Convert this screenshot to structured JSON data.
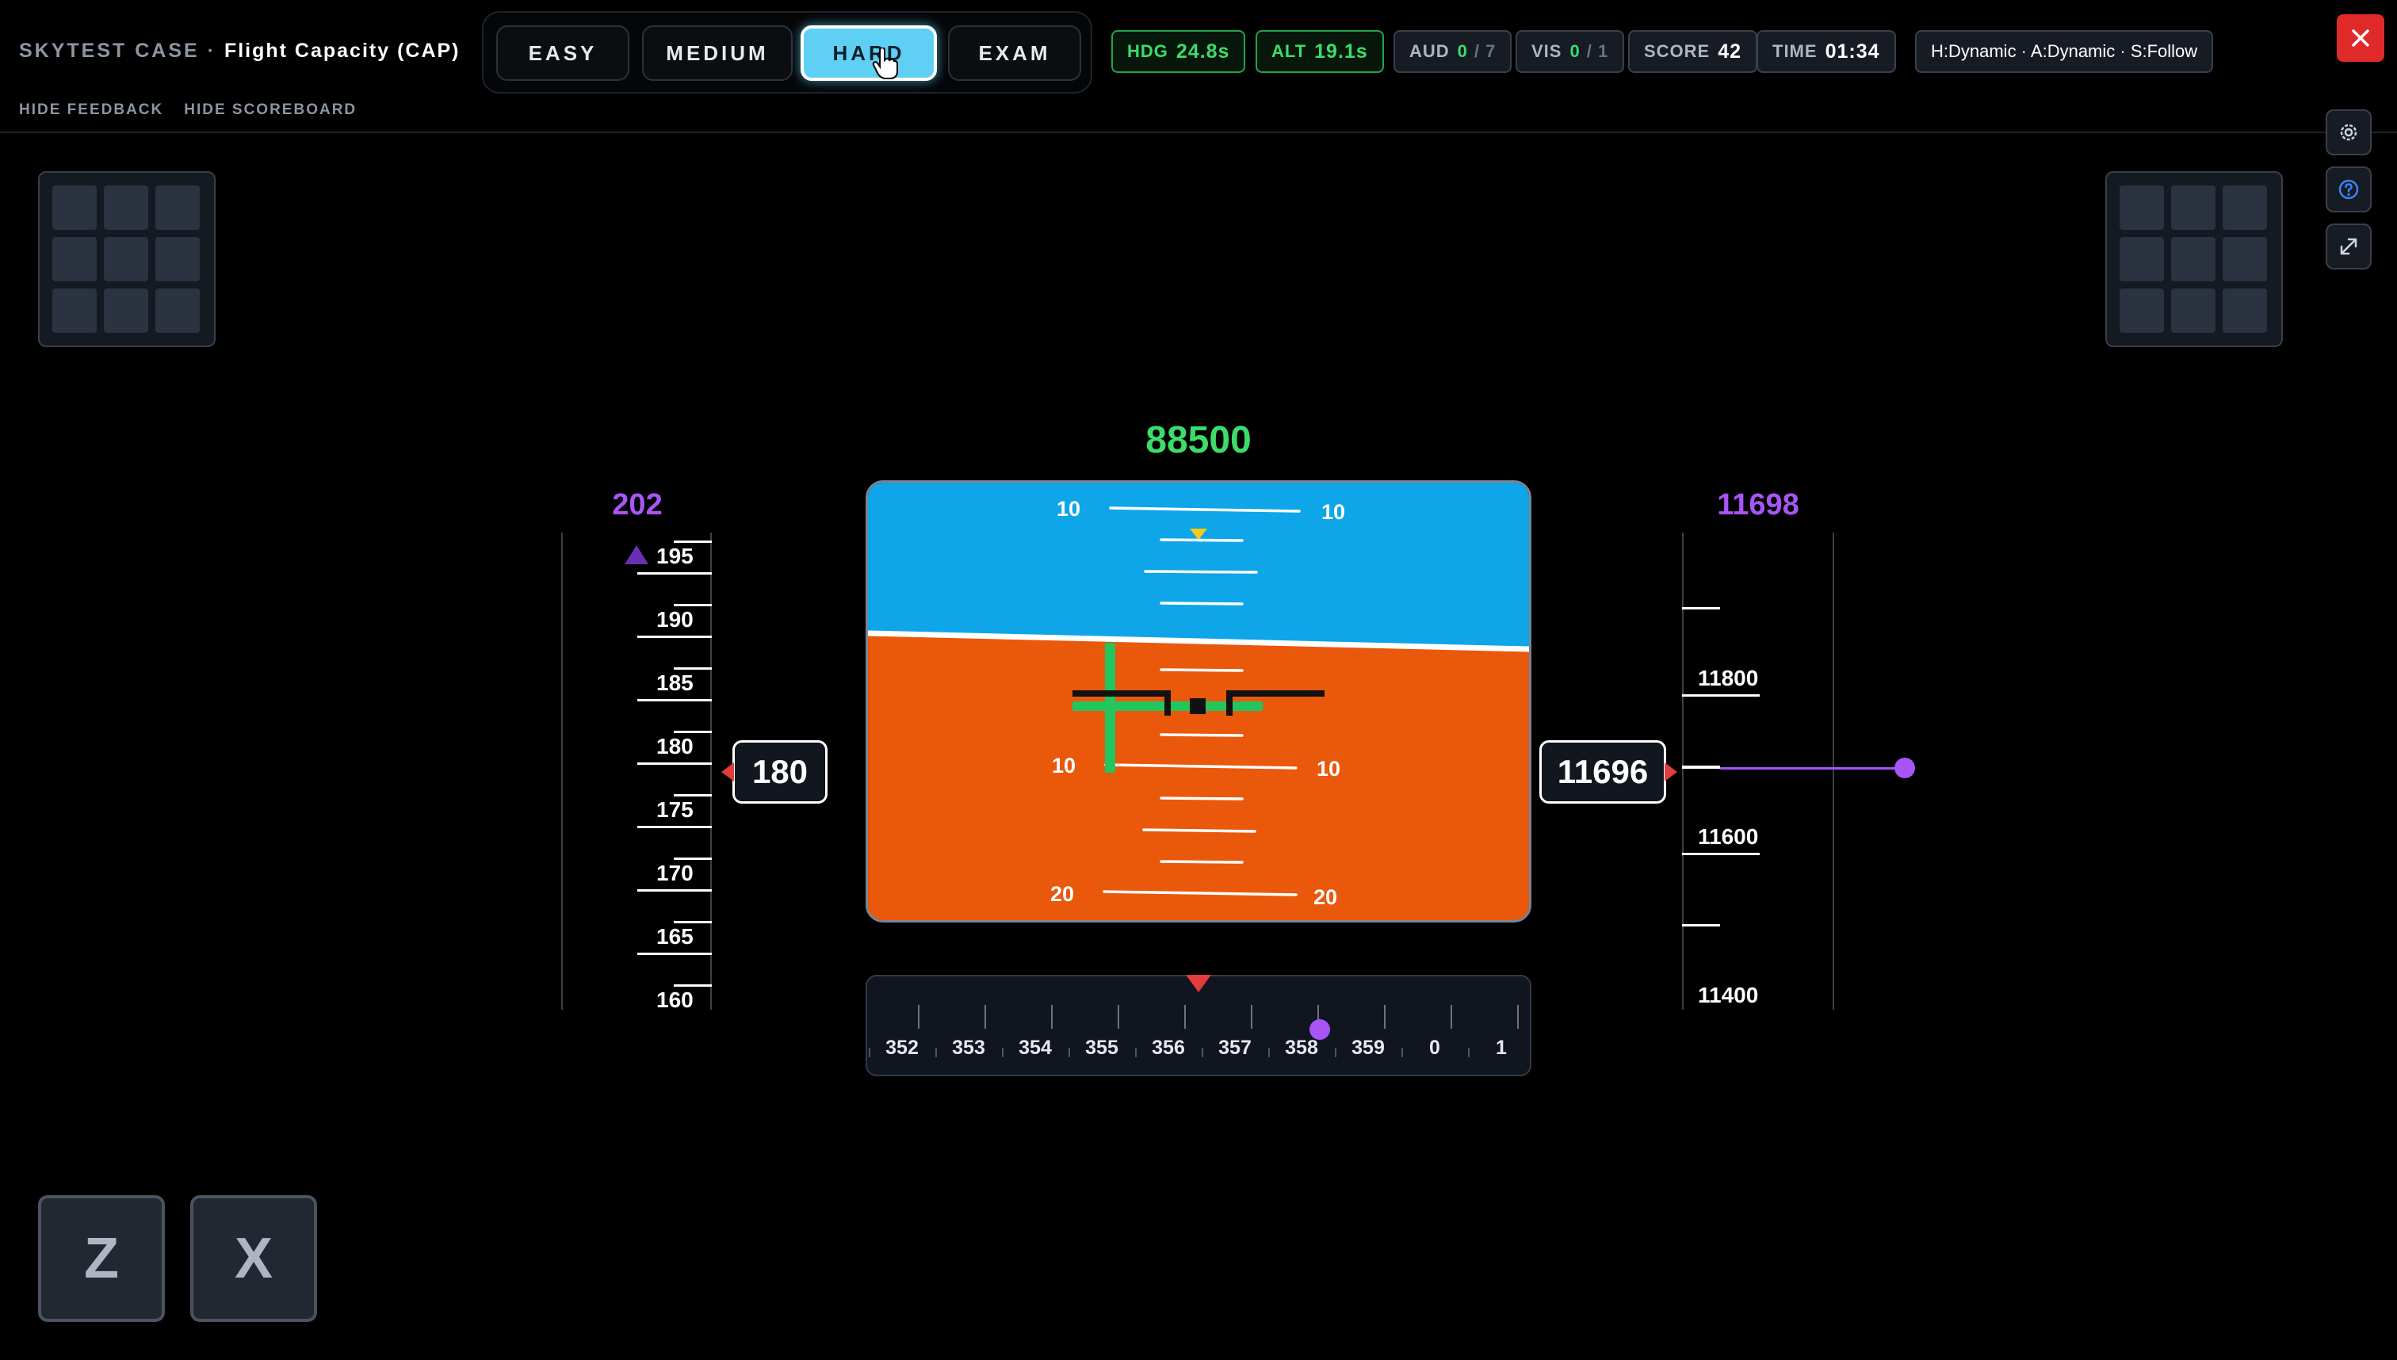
{
  "header": {
    "app_name": "SKYTEST CASE ·",
    "title": "Flight Capacity (CAP)",
    "toggles": [
      "HIDE FEEDBACK",
      "HIDE SCOREBOARD"
    ]
  },
  "difficulty": {
    "options": [
      "EASY",
      "MEDIUM",
      "HARD",
      "EXAM"
    ],
    "selected": "HARD"
  },
  "stats": {
    "hdg_label": "HDG",
    "hdg_value": "24.8s",
    "alt_label": "ALT",
    "alt_value": "19.1s",
    "aud_label": "AUD",
    "aud_value": "0",
    "aud_total": "/ 7",
    "vis_label": "VIS",
    "vis_value": "0",
    "vis_total": "/ 1",
    "score_label": "SCORE",
    "score_value": "42",
    "time_label": "TIME",
    "time_value": "01:34",
    "mode": "H:Dynamic · A:Dynamic · S:Follow"
  },
  "side_controls": [
    "gear-icon",
    "help-icon",
    "expand-icon"
  ],
  "keys": [
    "Z",
    "X"
  ],
  "instruments": {
    "center_target": "88500",
    "speed": {
      "target": "202",
      "current": "180",
      "labels": [
        "195",
        "190",
        "185",
        "180",
        "175",
        "170",
        "165",
        "160"
      ]
    },
    "altitude": {
      "target": "11698",
      "current": "11696",
      "labels": [
        "11800",
        "11600",
        "11400"
      ]
    },
    "pitch_labels": [
      "10",
      "10",
      "10",
      "10",
      "20",
      "20"
    ],
    "heading": {
      "labels": [
        "352",
        "353",
        "354",
        "355",
        "356",
        "357",
        "358",
        "359",
        "0",
        "1"
      ],
      "target_marker": 358
    }
  },
  "colors": {
    "sky": "#0ea5e9",
    "ground": "#ea580c",
    "target": "#a855f7",
    "accent_green": "#3ddc6a",
    "active_button": "#5fd0f4",
    "alert": "#e02a2a"
  }
}
